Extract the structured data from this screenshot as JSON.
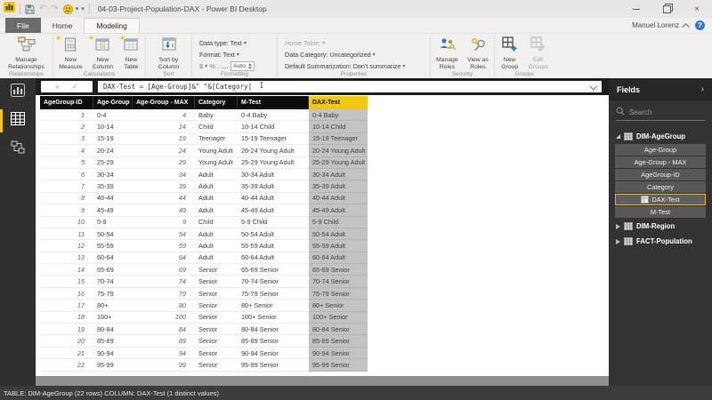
{
  "titlebar": {
    "title": "04-03-Project-Population-DAX - Power BI Desktop"
  },
  "tabs": {
    "file": "File",
    "home": "Home",
    "modeling": "Modeling",
    "active": "Modeling"
  },
  "account": {
    "user": "Manuel Lorenz",
    "help_glyph": "?"
  },
  "icons": {
    "undo": "↶",
    "redo": "↷",
    "caret_down": "▾",
    "check": "✓",
    "close_x": "×",
    "minimize": "–",
    "chevron_right": "›",
    "star": "★"
  },
  "ribbon": {
    "relationships": {
      "button": "Manage Relationships",
      "group": "Relationships"
    },
    "calculations": {
      "new_measure": "New Measure",
      "new_column": "New Column",
      "new_table": "New Table",
      "group": "Calculations"
    },
    "sort": {
      "button": "Sort by Column",
      "group": "Sort"
    },
    "formatting": {
      "data_type": "Data type: Text",
      "format": "Format: Text",
      "currency": "$",
      "percent": "%",
      "comma": ",",
      "auto": "Auto",
      "group": "Formatting"
    },
    "properties": {
      "home_table": "Home Table:",
      "data_category": "Data Category: Uncategorized",
      "default_summarization": "Default Summarization: Don't summarize",
      "group": "Properties"
    },
    "security": {
      "manage_roles": "Manage Roles",
      "view_as_roles": "View as Roles",
      "group": "Security"
    },
    "groups": {
      "new_group": "New Group",
      "edit_groups": "Edit Groups",
      "group": "Groups"
    }
  },
  "formula_bar": {
    "formula": "DAX-Test = [Age-Group]&\" \"&[Category]"
  },
  "nav": {
    "views": [
      "report",
      "data",
      "model"
    ],
    "selected": "data"
  },
  "table": {
    "columns": [
      "AgeGroup-ID",
      "Age-Group",
      "Age-Group - MAX",
      "Category",
      "M-Test",
      "DAX-Test"
    ],
    "selected_column": "DAX-Test",
    "rows": [
      [
        "1",
        "0-4",
        "4",
        "Baby",
        "0-4 Baby",
        "0-4 Baby"
      ],
      [
        "2",
        "10-14",
        "14",
        "Child",
        "10-14 Child",
        "10-14 Child"
      ],
      [
        "3",
        "15-19",
        "19",
        "Teenager",
        "15-19 Teenager",
        "15-19 Teenager"
      ],
      [
        "4",
        "20-24",
        "24",
        "Young Adult",
        "20-24 Young Adult",
        "20-24 Young Adult"
      ],
      [
        "5",
        "25-29",
        "29",
        "Young Adult",
        "25-29 Young Adult",
        "25-29 Young Adult"
      ],
      [
        "6",
        "30-34",
        "34",
        "Adult",
        "30-34 Adult",
        "30-34 Adult"
      ],
      [
        "7",
        "35-39",
        "39",
        "Adult",
        "35-39 Adult",
        "35-39 Adult"
      ],
      [
        "8",
        "40-44",
        "44",
        "Adult",
        "40-44 Adult",
        "40-44 Adult"
      ],
      [
        "9",
        "45-49",
        "49",
        "Adult",
        "45-49 Adult",
        "45-49 Adult"
      ],
      [
        "10",
        "5-9",
        "9",
        "Child",
        "5-9 Child",
        "5-9 Child"
      ],
      [
        "11",
        "50-54",
        "54",
        "Adult",
        "50-54 Adult",
        "50-54 Adult"
      ],
      [
        "12",
        "55-59",
        "59",
        "Adult",
        "55-59 Adult",
        "55-59 Adult"
      ],
      [
        "13",
        "60-64",
        "64",
        "Adult",
        "60-64 Adult",
        "60-64 Adult"
      ],
      [
        "14",
        "65-69",
        "69",
        "Senior",
        "65-69 Senior",
        "65-69 Senior"
      ],
      [
        "15",
        "70-74",
        "74",
        "Senior",
        "70-74 Senior",
        "70-74 Senior"
      ],
      [
        "16",
        "75-79",
        "79",
        "Senior",
        "75-79 Senior",
        "75-79 Senior"
      ],
      [
        "17",
        "80+",
        "80",
        "Senior",
        "80+ Senior",
        "80+ Senior"
      ],
      [
        "18",
        "100+",
        "100",
        "Senior",
        "100+ Senior",
        "100+ Senior"
      ],
      [
        "19",
        "80-84",
        "84",
        "Senior",
        "80-84 Senior",
        "80-84 Senior"
      ],
      [
        "20",
        "85-89",
        "89",
        "Senior",
        "85-89 Senior",
        "85-89 Senior"
      ],
      [
        "21",
        "90-94",
        "94",
        "Senior",
        "90-94 Senior",
        "90-94 Senior"
      ],
      [
        "22",
        "95-99",
        "99",
        "Senior",
        "95-99 Senior",
        "95-99 Senior"
      ]
    ]
  },
  "fields_panel": {
    "title": "Fields",
    "search_placeholder": "Search",
    "tables": [
      {
        "name": "DIM-AgeGroup",
        "expanded": true,
        "fields": [
          {
            "name": "Age-Group"
          },
          {
            "name": "Age-Group - MAX"
          },
          {
            "name": "AgeGroup-ID"
          },
          {
            "name": "Category"
          },
          {
            "name": "DAX-Test",
            "selected": true,
            "calculated": true
          },
          {
            "name": "M-Test"
          }
        ]
      },
      {
        "name": "DIM-Region",
        "expanded": false,
        "fields": []
      },
      {
        "name": "FACT-Population",
        "expanded": false,
        "fields": []
      }
    ]
  },
  "status_bar": {
    "text": "TABLE: DIM-AgeGroup (22 rows) COLUMN: DAX-Test (1 distinct values)"
  },
  "colors": {
    "accent_yellow": "#F2C80F",
    "selected_column_bg": "#C3C3C3",
    "header_bg": "#0C0C0C",
    "dark_panel": "#333333"
  }
}
